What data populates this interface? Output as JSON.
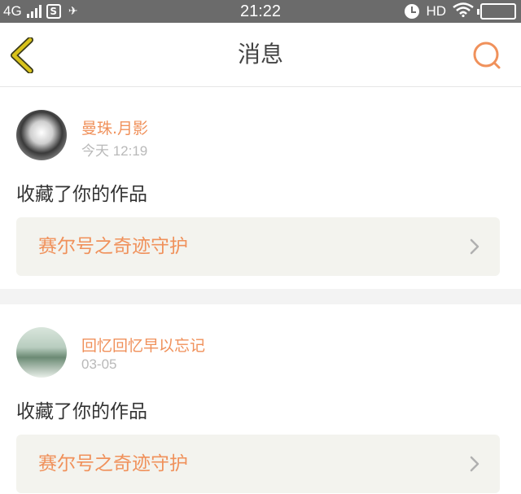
{
  "status_bar": {
    "network": "4G",
    "time": "21:22",
    "hd_label": "HD"
  },
  "nav": {
    "title": "消息",
    "back_icon": "chevron-left-icon",
    "search_icon": "search-icon",
    "accent_color": "#f0915b",
    "back_icon_color": "#c8b400"
  },
  "messages": [
    {
      "username": "曼珠.月影",
      "time": "今天 12:19",
      "action": "收藏了你的作品",
      "work_title": "赛尔号之奇迹守护"
    },
    {
      "username": "回忆回忆早以忘记",
      "time": "03-05",
      "action": "收藏了你的作品",
      "work_title": "赛尔号之奇迹守护"
    }
  ]
}
